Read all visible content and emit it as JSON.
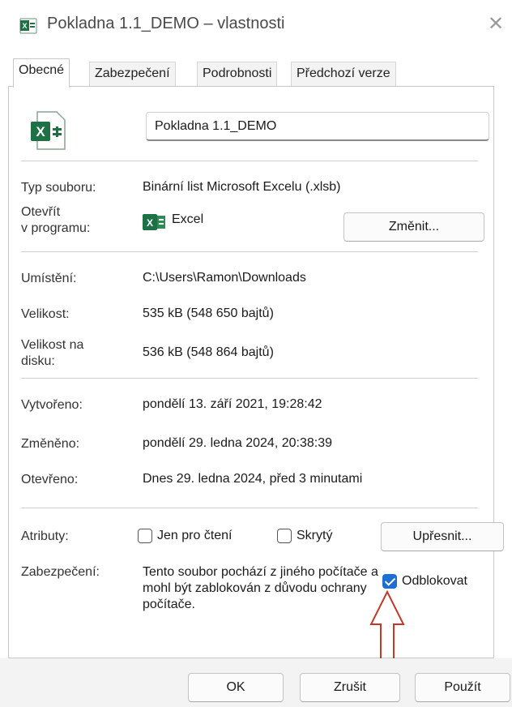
{
  "window": {
    "title": "Pokladna 1.1_DEMO – vlastnosti",
    "close_glyph": "✕"
  },
  "tabs": [
    {
      "label": "Obecné",
      "active": true
    },
    {
      "label": "Zabezpečení",
      "active": false
    },
    {
      "label": "Podrobnosti",
      "active": false
    },
    {
      "label": "Předchozí verze",
      "active": false
    }
  ],
  "general": {
    "file_name": "Pokladna 1.1_DEMO",
    "file_type_label": "Typ souboru:",
    "file_type_value": "Binární list Microsoft Excelu (.xlsb)",
    "opens_with_label_1": "Otevřít",
    "opens_with_label_2": "v programu:",
    "opens_with_value": "Excel",
    "change_button": "Změnit...",
    "location_label": "Umístění:",
    "location_value": "C:\\Users\\Ramon\\Downloads",
    "size_label": "Velikost:",
    "size_value": "535 kB (548 650 bajtů)",
    "size_on_disk_label_1": "Velikost na",
    "size_on_disk_label_2": "disku:",
    "size_on_disk_value": "536 kB (548 864 bajtů)",
    "created_label": "Vytvořeno:",
    "created_value": "pondělí 13. září 2021, 19:28:42",
    "modified_label": "Změněno:",
    "modified_value": "pondělí 29. ledna 2024, 20:38:39",
    "accessed_label": "Otevřeno:",
    "accessed_value": "Dnes 29. ledna 2024, před 3 minutami",
    "attributes_label": "Atributy:",
    "readonly_label": "Jen pro čtení",
    "readonly_checked": false,
    "hidden_label": "Skrytý",
    "hidden_checked": false,
    "advanced_button": "Upřesnit...",
    "security_label": "Zabezpečení:",
    "security_text": "Tento soubor pochází z jiného počítače a mohl být zablokován z důvodu ochrany počítače.",
    "unblock_label": "Odblokovat",
    "unblock_checked": true
  },
  "footer": {
    "ok": "OK",
    "cancel": "Zrušit",
    "apply": "Použít"
  },
  "icons": {
    "title": "excel-file-icon",
    "file": "excel-file-icon",
    "app": "excel-app-icon",
    "annotation": "red-arrow-icon"
  },
  "colors": {
    "excel_green": "#1e7145",
    "accent": "#1d6fd1",
    "annotation_red": "#c0392b"
  }
}
